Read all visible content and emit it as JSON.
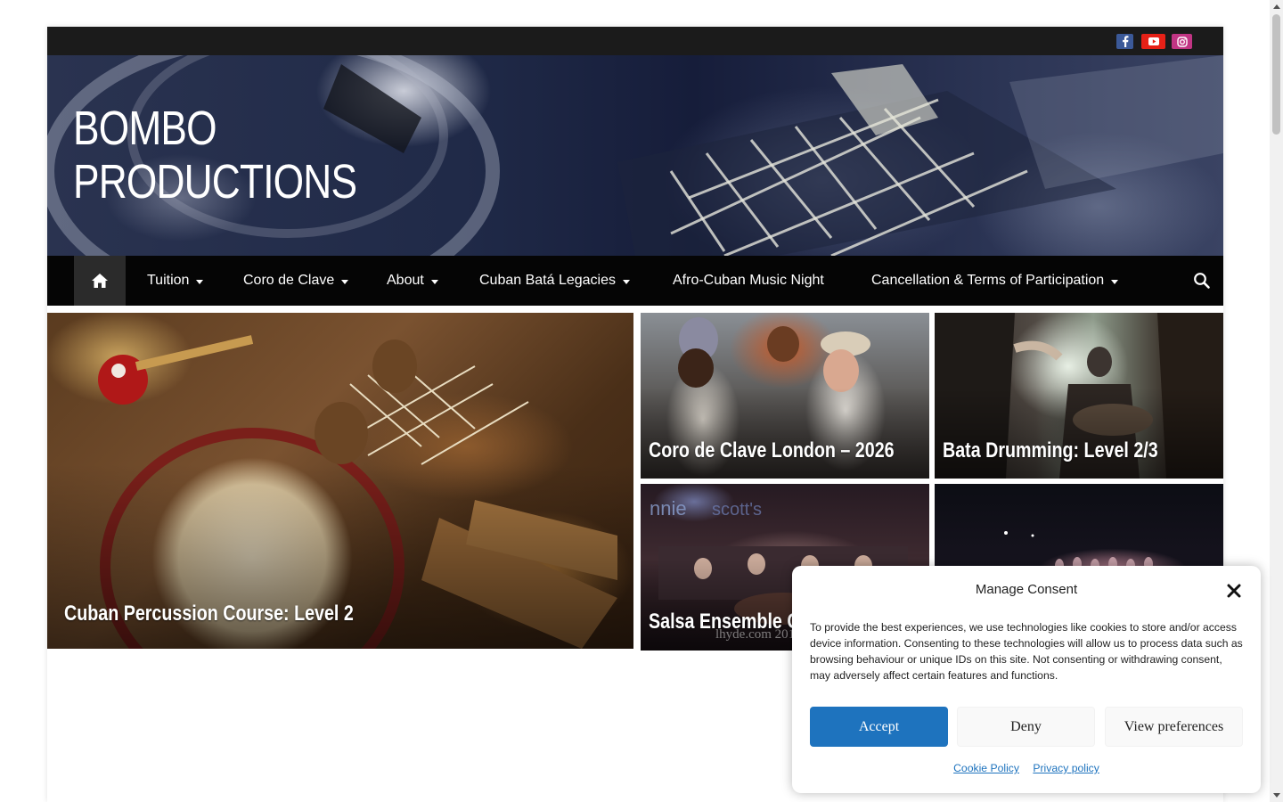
{
  "site": {
    "title_line1": "BOMBO",
    "title_line2": "PRODUCTIONS"
  },
  "social": [
    {
      "name": "facebook-icon",
      "color": "#3b5998"
    },
    {
      "name": "youtube-icon",
      "color": "#e62117"
    },
    {
      "name": "instagram-icon",
      "color": "#c13584"
    }
  ],
  "nav": {
    "home_icon": "home-icon",
    "items": [
      {
        "label": "Tuition",
        "dropdown": true
      },
      {
        "label": "Coro de Clave",
        "dropdown": true
      },
      {
        "label": "About",
        "dropdown": true
      },
      {
        "label": "Cuban Batá Legacies",
        "dropdown": true
      },
      {
        "label": "Afro-Cuban Music Night",
        "dropdown": false
      },
      {
        "label": "Cancellation & Terms of Participation",
        "dropdown": true
      }
    ],
    "search_icon": "search-icon"
  },
  "featured": [
    {
      "caption": "Cuban Percussion Course: Level 2"
    },
    {
      "caption": "Coro de Clave London – 2026"
    },
    {
      "caption": "Bata Drumming: Level 2/3"
    },
    {
      "caption": "Salsa Ensemble Co",
      "watermark": "lhyde.com 2017"
    },
    {
      "caption": ""
    }
  ],
  "consent": {
    "title": "Manage Consent",
    "text": "To provide the best experiences, we use technologies like cookies to store and/or access device information. Consenting to these technologies will allow us to process data such as browsing behaviour or unique IDs on this site. Not consenting or withdrawing consent, may adversely affect certain features and functions.",
    "accept_label": "Accept",
    "deny_label": "Deny",
    "prefs_label": "View preferences",
    "cookie_policy_label": "Cookie Policy",
    "privacy_policy_label": "Privacy policy",
    "accent_color": "#1e73be"
  }
}
